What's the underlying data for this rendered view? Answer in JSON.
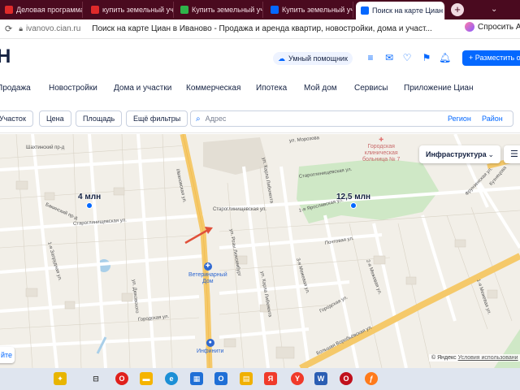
{
  "browser": {
    "tabs": [
      {
        "label": "Деловая программа",
        "favicon_color": "#e02a2a",
        "active": false
      },
      {
        "label": "купить земельный уч",
        "favicon_color": "#e02a2a",
        "active": false
      },
      {
        "label": "Купить земельный уч",
        "favicon_color": "#2fb34a",
        "active": false
      },
      {
        "label": "Купить земельный уч",
        "favicon_color": "#0468ff",
        "active": false
      },
      {
        "label": "Поиск на карте Циан",
        "favicon_color": "#0468ff",
        "active": true
      }
    ],
    "close_glyph": "×",
    "new_tab_glyph": "+",
    "address": {
      "url": "ivanovo.cian.ru",
      "page_title": "Поиск на карте Циан в Иваново - Продажа и аренда квартир, новостройки, дома и участ...",
      "ask_label": "Спросить А"
    }
  },
  "header": {
    "logo": "Н",
    "assistant_label": "Умный помощник",
    "place_ad_label": "+ Разместить об",
    "icons": [
      "compare-icon",
      "chat-icon",
      "favorite-icon",
      "notifications-icon"
    ]
  },
  "menu": [
    "Продажа",
    "Новостройки",
    "Дома и участки",
    "Коммерческая",
    "Ипотека",
    "Мой дом",
    "Сервисы",
    "Приложение Циан"
  ],
  "filters": {
    "buttons": [
      "Участок",
      "Цена",
      "Площадь",
      "Ещё фильтры"
    ],
    "search_placeholder": "Адрес",
    "region_link": "Регион",
    "district_link": "Район"
  },
  "map": {
    "infrastructure_label": "Инфраструктура",
    "prices": [
      {
        "label": "4 млн"
      },
      {
        "label": "12,5 млн"
      }
    ],
    "pois": [
      {
        "name": "Ветеринарный\nДом"
      },
      {
        "name": "Инфинити"
      }
    ],
    "hospital": "Городская\nклиническая\nбольница № 7",
    "streets": [
      "Ивановская ул.",
      "Староглинищевская ул.",
      "Староглинищевская ул.",
      "Староглинищевская ул.",
      "ул. Карла Либкнехта",
      "ул. Розы Люксембург",
      "ул. Карла Либкнехта",
      "3-я Межевая ул.",
      "2-я Межевая ул.",
      "Большая Воробьёвская ул.",
      "Городская ул.",
      "Городская ул.",
      "ул. Дюковского",
      "Почтовая ул.",
      "1-я Ярославская ул.",
      "Шахтинский пр-д",
      "Бакинский пр-д",
      "1-я Запрудная ул.",
      "1-я Межевая ул.",
      "ул. Морозова",
      "Фрунзенская ул.",
      "Кузнецова"
    ],
    "copyright": "© Яндекс",
    "terms_link": "Условия использовани",
    "left_button": "йте"
  },
  "taskbar": {
    "items": [
      {
        "icon": "copilot-icon",
        "color": "#e8b500"
      },
      {
        "icon": "task-view-icon",
        "color": "#333333"
      },
      {
        "icon": "opera-icon",
        "color": "#e0201c"
      },
      {
        "icon": "file-explorer-icon",
        "color": "#f5b400"
      },
      {
        "icon": "edge-icon",
        "color": "#1b8fd6"
      },
      {
        "icon": "store-icon",
        "color": "#1f6fd6"
      },
      {
        "icon": "outlook-icon",
        "color": "#1f6fd6"
      },
      {
        "icon": "files-icon",
        "color": "#f0b000"
      },
      {
        "icon": "yandex-icon",
        "color": "#f03a2a"
      },
      {
        "icon": "yandex-browser-icon",
        "color": "#f03a2a"
      },
      {
        "icon": "word-icon",
        "color": "#2b5eb3"
      },
      {
        "icon": "opera-gx-icon",
        "color": "#c0101c"
      },
      {
        "icon": "firefox-icon",
        "color": "#ff7b1c"
      }
    ]
  },
  "colors": {
    "tabbar": "#4a0a1f",
    "accent": "#0468ff",
    "map_bg": "#f2efe8",
    "park": "#cfe8c6",
    "main_road": "#f5c96a",
    "arrow": "#e0503a"
  }
}
